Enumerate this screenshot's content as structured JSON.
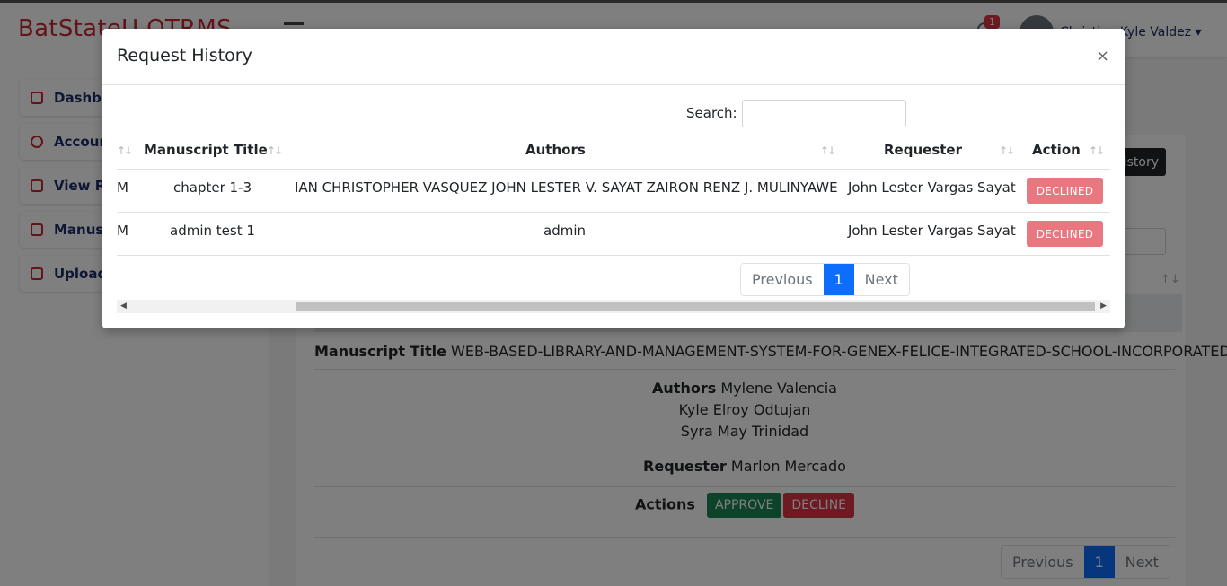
{
  "app": {
    "brand": "BatStateU OTRMS",
    "notification_count": "1",
    "user_name": "Christian Kyle Valdez ▾"
  },
  "sidebar": {
    "items": [
      {
        "label": "Dashboard",
        "icon": "grid-icon"
      },
      {
        "label": "Accounts",
        "icon": "user-icon"
      },
      {
        "label": "View Requests",
        "icon": "book-icon"
      },
      {
        "label": "Manuscripts",
        "icon": "pdf-icon"
      },
      {
        "label": "Upload",
        "icon": "upload-icon"
      }
    ]
  },
  "background": {
    "history_button": "History",
    "detail": {
      "manuscript_label": "Manuscript Title",
      "manuscript_value": "WEB-BASED-LIBRARY-AND-MANAGEMENT-SYSTEM-FOR-GENEX-FELICE-INTEGRATED-SCHOOL-INCORPORATED",
      "authors_label": "Authors",
      "authors": [
        "Mylene Valencia",
        "Kyle Elroy Odtujan",
        "Syra May Trinidad"
      ],
      "requester_label": "Requester",
      "requester_value": "Marlon Mercado",
      "actions_label": "Actions",
      "approve_label": "APPROVE",
      "decline_label": "DECLINE"
    },
    "pagination": {
      "previous": "Previous",
      "page": "1",
      "next": "Next"
    }
  },
  "modal": {
    "title": "Request History",
    "close_label": "×",
    "search_label": "Search:",
    "search_value": "",
    "columns": [
      "Manuscript Title",
      "Authors",
      "Requester",
      "Action"
    ],
    "sort_icon": "↑↓",
    "rows": [
      {
        "first": "M",
        "title": "chapter 1-3",
        "authors": "IAN CHRISTOPHER VASQUEZ JOHN LESTER V. SAYAT ZAIRON RENZ J. MULINYAWE",
        "requester": "John Lester Vargas Sayat",
        "action": "DECLINED"
      },
      {
        "first": "M",
        "title": "admin test 1",
        "authors": "admin",
        "requester": "John Lester Vargas Sayat",
        "action": "DECLINED"
      }
    ],
    "pagination": {
      "previous": "Previous",
      "page": "1",
      "next": "Next"
    },
    "scroll_left_arrow": "◀",
    "scroll_right_arrow": "▶"
  },
  "colors": {
    "brand": "#c62834",
    "declined_badge": "#e97780",
    "approve": "#198754",
    "decline": "#dc3545",
    "active_page": "#0d6efd"
  }
}
